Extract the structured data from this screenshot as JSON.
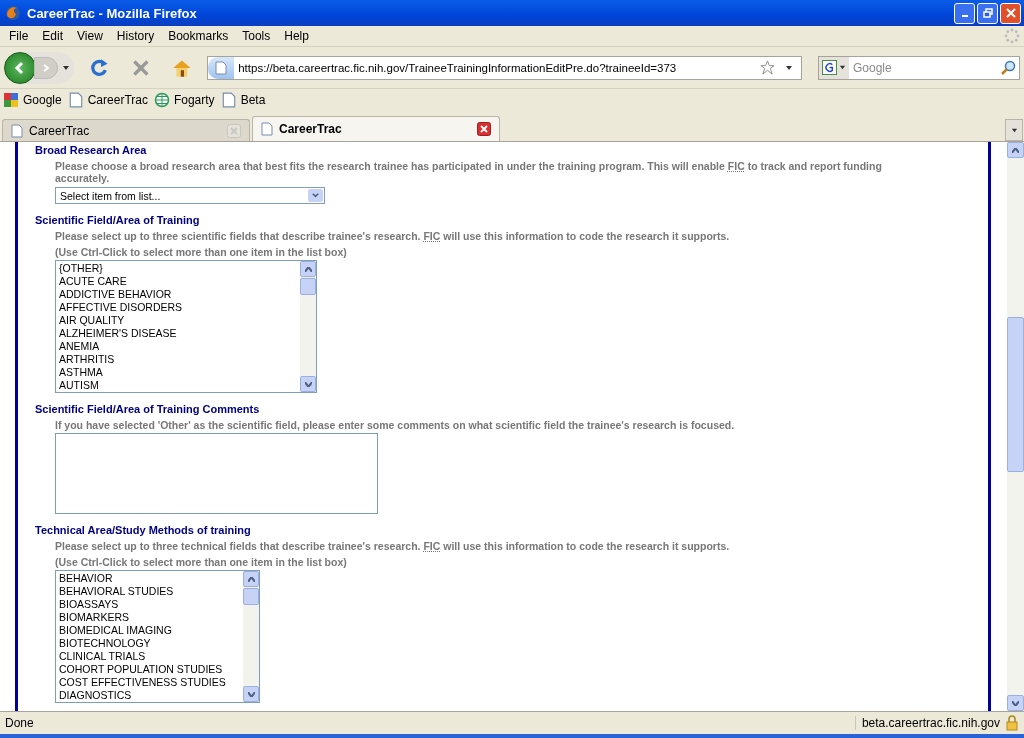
{
  "window": {
    "title": "CareerTrac - Mozilla Firefox"
  },
  "menu": [
    "File",
    "Edit",
    "View",
    "History",
    "Bookmarks",
    "Tools",
    "Help"
  ],
  "toolbar": {
    "url": "https://beta.careertrac.fic.nih.gov/TraineeTrainingInformationEditPre.do?traineeId=373",
    "search_placeholder": "Google"
  },
  "bookmarks": [
    {
      "label": "Google",
      "kind": "google"
    },
    {
      "label": "CareerTrac",
      "kind": "page"
    },
    {
      "label": "Fogarty",
      "kind": "globe"
    },
    {
      "label": "Beta",
      "kind": "page"
    }
  ],
  "tabs": [
    {
      "label": "CareerTrac",
      "selected": false
    },
    {
      "label": "CareerTrac",
      "selected": true
    }
  ],
  "sections": [
    {
      "kind": "select",
      "heading": "Broad Research Area",
      "description": {
        "before": "Please choose a broad research area that best fits the research trainee has participated in under the training program. This will enable",
        "abbr": "FIC",
        "after": "to track and report funding accurately."
      },
      "value": "Select item from list..."
    },
    {
      "kind": "listbox",
      "heading": "Scientific Field/Area of Training",
      "description": {
        "before": "Please select up to three scientific fields that describe trainee's research.",
        "abbr": "FIC",
        "after": "will use this information to code the research it supports."
      },
      "hint": "(Use Ctrl-Click to select more than one item in the list box)",
      "items": [
        "{OTHER}",
        "ACUTE CARE",
        "ADDICTIVE BEHAVIOR",
        "AFFECTIVE DISORDERS",
        "AIR QUALITY",
        "ALZHEIMER'S DISEASE",
        "ANEMIA",
        "ARTHRITIS",
        "ASTHMA",
        "AUTISM"
      ]
    },
    {
      "kind": "textarea",
      "heading": "Scientific Field/Area of Training Comments",
      "description": {
        "before": "If you have selected 'Other' as the scientific field, please enter some comments on what scientific field the trainee's research is focused."
      }
    },
    {
      "kind": "listbox",
      "heading": "Technical Area/Study Methods of training",
      "description": {
        "before": "Please select up to three technical fields that describe trainee's research.",
        "abbr": "FIC",
        "after": "will use this information to code the research it supports."
      },
      "hint": "(Use Ctrl-Click to select more than one item in the list box)",
      "items": [
        "BEHAVIOR",
        "BEHAVIORAL STUDIES",
        "BIOASSAYS",
        "BIOMARKERS",
        "BIOMEDICAL IMAGING",
        "BIOTECHNOLOGY",
        "CLINICAL TRIALS",
        "COHORT POPULATION STUDIES",
        "COST EFFECTIVENESS STUDIES",
        "DIAGNOSTICS"
      ]
    }
  ],
  "status": {
    "text": "Done",
    "host": "beta.careertrac.fic.nih.gov"
  }
}
